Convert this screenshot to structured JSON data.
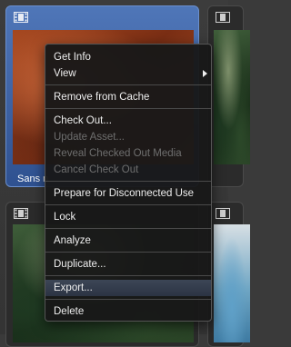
{
  "tiles": [
    {
      "id": "top-left",
      "label": "Sans n",
      "selected": true,
      "icon": "film-icon"
    },
    {
      "id": "top-right",
      "label": "",
      "selected": false,
      "icon": "film-icon"
    },
    {
      "id": "bottom-left",
      "label": "",
      "selected": false,
      "icon": "film-icon"
    },
    {
      "id": "bottom-right",
      "label": "",
      "selected": false,
      "icon": "film-icon"
    }
  ],
  "context_menu": {
    "items": [
      {
        "label": "Get Info",
        "enabled": true
      },
      {
        "label": "View",
        "enabled": true,
        "has_submenu": true,
        "arrow_icon": "submenu-arrow-icon"
      },
      {
        "label": "Remove from Cache",
        "enabled": true
      },
      {
        "label": "Check Out...",
        "enabled": true
      },
      {
        "label": "Update Asset...",
        "enabled": false
      },
      {
        "label": "Reveal Checked Out Media",
        "enabled": false
      },
      {
        "label": "Cancel Check Out",
        "enabled": false
      },
      {
        "label": "Prepare for Disconnected Use",
        "enabled": true
      },
      {
        "label": "Lock",
        "enabled": true
      },
      {
        "label": "Analyze",
        "enabled": true
      },
      {
        "label": "Duplicate...",
        "enabled": true
      },
      {
        "label": "Export...",
        "enabled": true,
        "highlighted": true
      },
      {
        "label": "Delete",
        "enabled": true
      }
    ]
  },
  "colors": {
    "selection_blue": "#4f76b8",
    "menu_background": "#181818",
    "menu_highlight": "#3c4656",
    "disabled_text": "#6e6e6e"
  }
}
